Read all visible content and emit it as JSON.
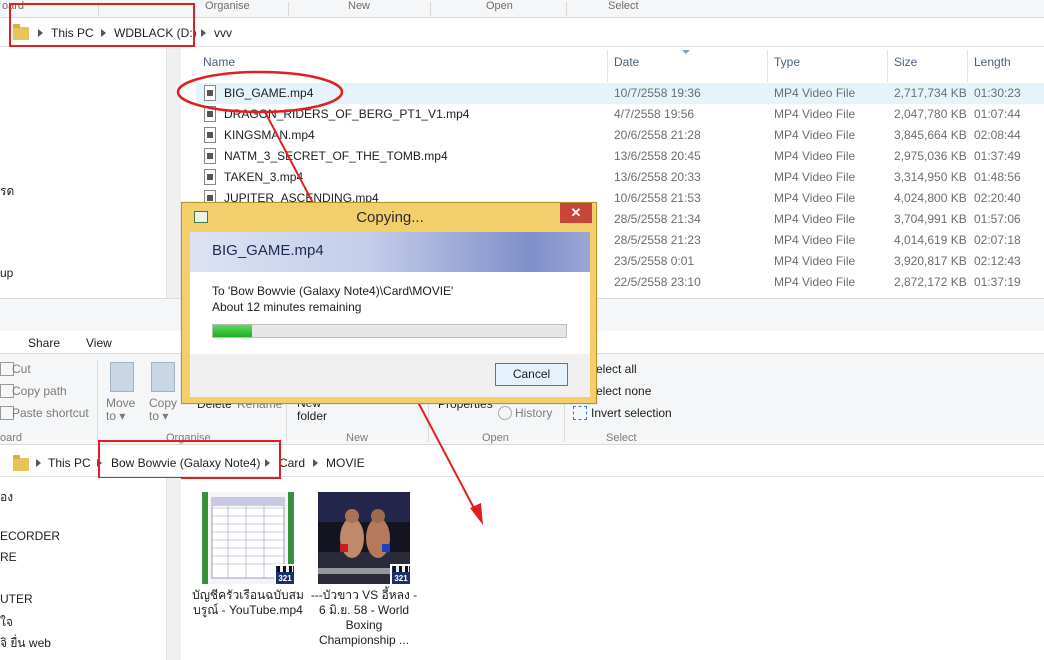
{
  "top_ribbon_groups": [
    "oard",
    "Organise",
    "New",
    "Open",
    "Select"
  ],
  "top_breadcrumb": [
    "This PC",
    "WDBLACK (D:)",
    "vvv"
  ],
  "top_nav_fragments": [
    "รด",
    "up"
  ],
  "columns": {
    "name": "Name",
    "date": "Date",
    "type": "Type",
    "size": "Size",
    "length": "Length"
  },
  "files": [
    {
      "name": "BIG_GAME.mp4",
      "date": "10/7/2558 19:36",
      "type": "MP4 Video File",
      "size": "2,717,734 KB",
      "length": "01:30:23"
    },
    {
      "name": "DRAGON_RIDERS_OF_BERG_PT1_V1.mp4",
      "date": "4/7/2558 19:56",
      "type": "MP4 Video File",
      "size": "2,047,780 KB",
      "length": "01:07:44"
    },
    {
      "name": "KINGSMAN.mp4",
      "date": "20/6/2558 21:28",
      "type": "MP4 Video File",
      "size": "3,845,664 KB",
      "length": "02:08:44"
    },
    {
      "name": "NATM_3_SECRET_OF_THE_TOMB.mp4",
      "date": "13/6/2558 20:45",
      "type": "MP4 Video File",
      "size": "2,975,036 KB",
      "length": "01:37:49"
    },
    {
      "name": "TAKEN_3.mp4",
      "date": "13/6/2558 20:33",
      "type": "MP4 Video File",
      "size": "3,314,950 KB",
      "length": "01:48:56"
    },
    {
      "name": "JUPITER_ASCENDING.mp4",
      "date": "10/6/2558 21:53",
      "type": "MP4 Video File",
      "size": "4,024,800 KB",
      "length": "02:20:40"
    },
    {
      "name": "",
      "date": "28/5/2558 21:34",
      "type": "MP4 Video File",
      "size": "3,704,991 KB",
      "length": "01:57:06"
    },
    {
      "name": "",
      "date": "28/5/2558 21:23",
      "type": "MP4 Video File",
      "size": "4,014,619 KB",
      "length": "02:07:18"
    },
    {
      "name": "",
      "date": "23/5/2558 0:01",
      "type": "MP4 Video File",
      "size": "3,920,817 KB",
      "length": "02:12:43"
    },
    {
      "name": "",
      "date": "22/5/2558 23:10",
      "type": "MP4 Video File",
      "size": "2,872,172 KB",
      "length": "01:37:19"
    }
  ],
  "dialog": {
    "title": "Copying...",
    "close_label": "✕",
    "filename": "BIG_GAME.mp4",
    "destination": "To 'Bow Bowvie (Galaxy Note4)\\Card\\MOVIE'",
    "time_remaining": "About 12 minutes remaining",
    "progress": 0.11,
    "cancel_label": "Cancel"
  },
  "ribbon_tabs": [
    "Share",
    "View"
  ],
  "ribbon": {
    "cut": "Cut",
    "copy_path": "Copy path",
    "paste_shortcut": "Paste shortcut",
    "move_to": "Move\nto ▾",
    "copy_to": "Copy\nto ▾",
    "delete": "Delete",
    "rename": "Rename",
    "new_folder": "New\nfolder",
    "properties": "Properties",
    "history": "History",
    "select_all": "elect all",
    "select_none": "elect none",
    "invert_selection": "Invert selection",
    "groups": {
      "clipboard": "oard",
      "organise": "Organise",
      "new": "New",
      "open": "Open",
      "select": "Select"
    }
  },
  "bottom_breadcrumb": [
    "This PC",
    "Bow Bowvie (Galaxy Note4)",
    "Card",
    "MOVIE"
  ],
  "bottom_nav": [
    "อง",
    "ECORDER",
    "RE",
    "UTER",
    "ใจ",
    "จิ ยื่น web"
  ],
  "thumbnails": [
    {
      "label": "บัญชีครัวเรือนฉบับสมบรูณ์ - YouTube.mp4"
    },
    {
      "label": "---บัวขาว VS อี้หลง - 6 มิ.ย. 58 - World Boxing Championship ..."
    }
  ],
  "badge_text": "321",
  "colors": {
    "highlight_red": "#e02020",
    "dialog_frame": "#f3cf6b",
    "progress_green": "#1fae1f",
    "selected_row": "#e5f3fb"
  }
}
